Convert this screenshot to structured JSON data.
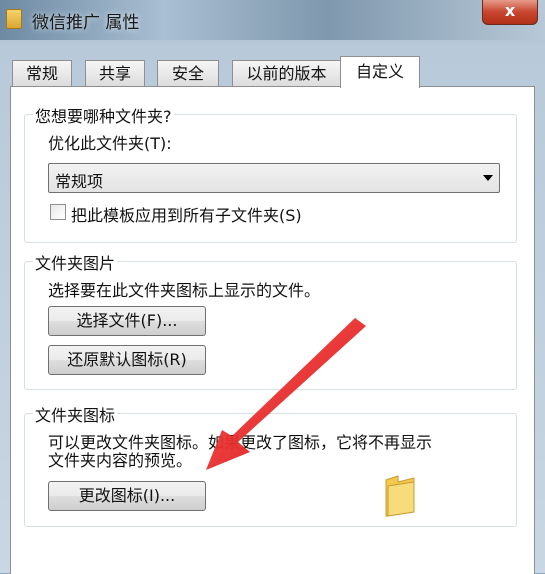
{
  "window": {
    "title": "微信推广 属性",
    "close_label": "x"
  },
  "tabs": [
    "常规",
    "共享",
    "安全",
    "以前的版本",
    "自定义"
  ],
  "active_tab": "自定义",
  "folder_type": {
    "heading": "您想要哪种文件夹?",
    "optimize_label": "优化此文件夹(T):",
    "selected_value": "常规项",
    "apply_subfolders_label": "把此模板应用到所有子文件夹(S)",
    "apply_subfolders_checked": false
  },
  "folder_picture": {
    "heading": "文件夹图片",
    "description": "选择要在此文件夹图标上显示的文件。",
    "choose_file_label": "选择文件(F)...",
    "restore_default_label": "还原默认图标(R)"
  },
  "folder_icon": {
    "heading": "文件夹图标",
    "description_line1": "可以更改文件夹图标。如果更改了图标，它将不再显示",
    "description_line2": "文件夹内容的预览。",
    "change_icon_label": "更改图标(I)..."
  },
  "colors": {
    "arrow": "#e02020",
    "folder": "#f2c94c"
  },
  "icons": [
    "folder-icon",
    "close-icon",
    "chevron-down-icon",
    "red-arrow-annotation"
  ]
}
